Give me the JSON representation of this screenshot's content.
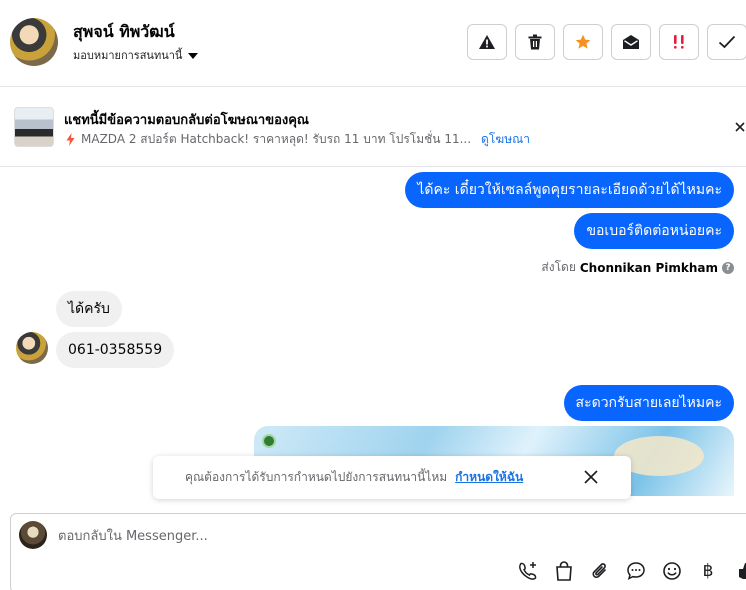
{
  "header": {
    "contact_name": "สุพจน์ ทิพวัฒน์",
    "assign_label": "มอบหมายการสนทนานี้",
    "toolbar": [
      {
        "name": "report-spam-button",
        "icon": "warning-icon"
      },
      {
        "name": "delete-button",
        "icon": "trash-icon"
      },
      {
        "name": "star-button",
        "icon": "star-icon",
        "color": "#f7901e"
      },
      {
        "name": "mark-unread-button",
        "icon": "envelope-open-icon"
      },
      {
        "name": "follow-up-button",
        "icon": "double-exclamation-icon",
        "color": "#e41e3f"
      },
      {
        "name": "mark-done-button",
        "icon": "check-icon"
      }
    ]
  },
  "ad": {
    "title": "แชทนี้มีข้อความตอบกลับต่อโฆษณาของคุณ",
    "text": "MAZDA 2 สปอร์ต Hatchback! ราคาหลุด! รับรถ 11 บาท โปรโมชั่น 11...",
    "link": "ดูโฆษณา"
  },
  "messages": {
    "out1": "ได้คะ เดี๋ยวให้เซลล์พูดคุยรายละเอียดด้วยได้ไหมคะ",
    "out2": "ขอเบอร์ติดต่อหน่อยคะ",
    "sent_by_prefix": "ส่งโดย",
    "sent_by_name": "Chonnikan Pimkham",
    "in1": "ได้ครับ",
    "in2": "061-0358559",
    "out3": "สะดวกรับสายเลยไหมคะ"
  },
  "notice": {
    "text": "คุณต้องการได้รับการกำหนดไปยังการสนทนานี้ไหม",
    "link": "กำหนดให้ฉัน"
  },
  "composer": {
    "placeholder": "ตอบกลับใน Messenger..."
  },
  "colors": {
    "brand_blue": "#0866ff",
    "link_blue": "#1b74e4"
  }
}
